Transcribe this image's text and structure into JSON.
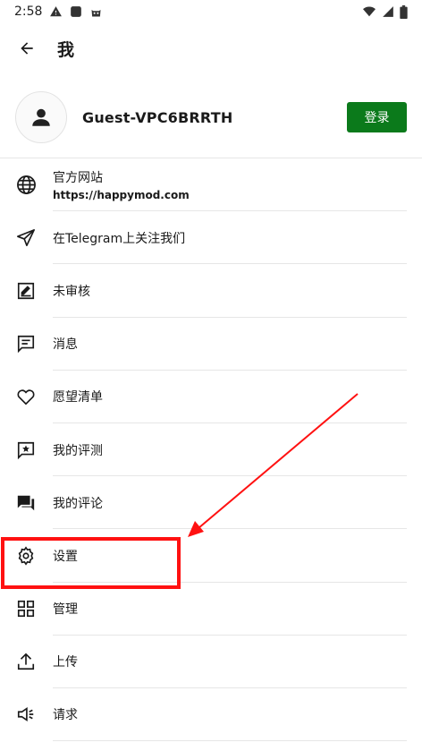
{
  "status": {
    "time": "2:58"
  },
  "header": {
    "title": "我"
  },
  "profile": {
    "username": "Guest-VPC6BRRTH",
    "login_label": "登录"
  },
  "menu": [
    {
      "id": "website",
      "icon": "globe-icon",
      "label": "官方网站",
      "sub": "https://happymod.com"
    },
    {
      "id": "telegram",
      "icon": "send-icon",
      "label": "在Telegram上关注我们"
    },
    {
      "id": "unreviewed",
      "icon": "review-pen-icon",
      "label": "未审核"
    },
    {
      "id": "messages",
      "icon": "message-icon",
      "label": "消息"
    },
    {
      "id": "wishlist",
      "icon": "heart-icon",
      "label": "愿望清单"
    },
    {
      "id": "my-reviews",
      "icon": "star-comment-icon",
      "label": "我的评测"
    },
    {
      "id": "my-comments",
      "icon": "comments-icon",
      "label": "我的评论"
    },
    {
      "id": "settings",
      "icon": "gear-icon",
      "label": "设置"
    },
    {
      "id": "manage",
      "icon": "grid-icon",
      "label": "管理"
    },
    {
      "id": "upload",
      "icon": "upload-icon",
      "label": "上传"
    },
    {
      "id": "request",
      "icon": "megaphone-icon",
      "label": "请求"
    }
  ],
  "annotation": {
    "color": "#ff1111"
  }
}
